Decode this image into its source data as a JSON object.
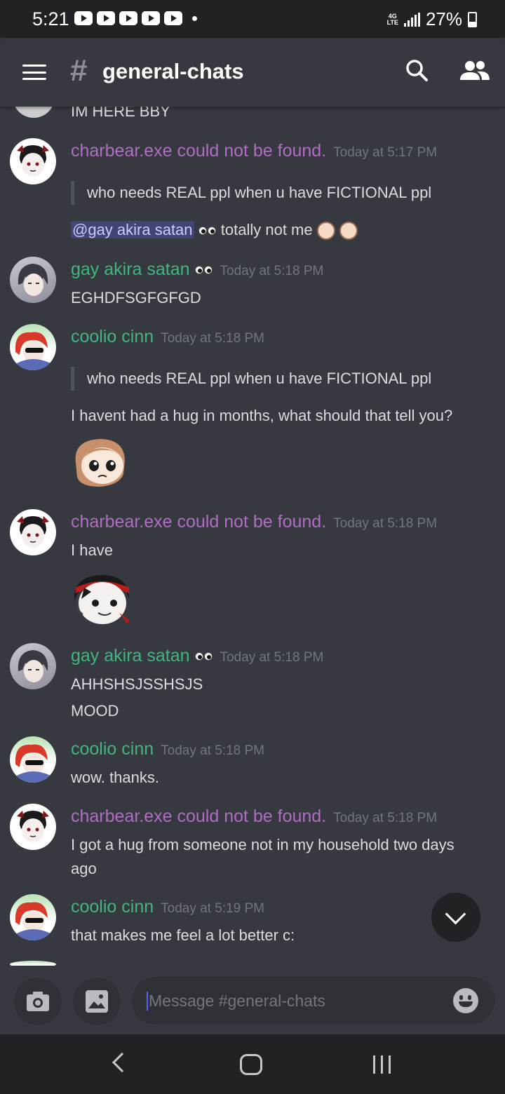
{
  "status_bar": {
    "time": "5:21",
    "battery": "27%",
    "network": "4G LTE"
  },
  "header": {
    "channel_name": "general-chats"
  },
  "colors": {
    "charbear": "#b16dc4",
    "green_user": "#43b581",
    "timestamp": "#72767d",
    "background": "#36393f"
  },
  "messages": {
    "m0": {
      "text": "IM HERE BBY"
    },
    "m1": {
      "author": "charbear.exe could not be found.",
      "timestamp": "Today at 5:17 PM",
      "quote": "who needs REAL ppl when u have FICTIONAL ppl",
      "mention": "@gay akira satan",
      "text_after_mention": "totally not me"
    },
    "m2": {
      "author": "gay akira satan",
      "timestamp": "Today at 5:18 PM",
      "text": "EGHDFSGFGFGD"
    },
    "m3": {
      "author": "coolio cinn",
      "timestamp": "Today at 5:18 PM",
      "quote": "who needs REAL ppl when u have FICTIONAL ppl",
      "text": "I havent had a hug in months, what should that tell you?"
    },
    "m4": {
      "author": "charbear.exe could not be found.",
      "timestamp": "Today at 5:18 PM",
      "text": "I have"
    },
    "m5": {
      "author": "gay akira satan",
      "timestamp": "Today at 5:18 PM",
      "line1": "AHHSHSJSSHSJS",
      "line2": "MOOD"
    },
    "m6": {
      "author": "coolio cinn",
      "timestamp": "Today at 5:18 PM",
      "text": "wow. thanks."
    },
    "m7": {
      "author": "charbear.exe could not be found.",
      "timestamp": "Today at 5:18 PM",
      "line1": "I got a hug from someone not in my household two days",
      "line2": "ago"
    },
    "m8": {
      "author": "coolio cinn",
      "timestamp": "Today at 5:19 PM",
      "text": "that makes me feel a lot better c:"
    }
  },
  "composer": {
    "placeholder": "Message #general-chats"
  }
}
